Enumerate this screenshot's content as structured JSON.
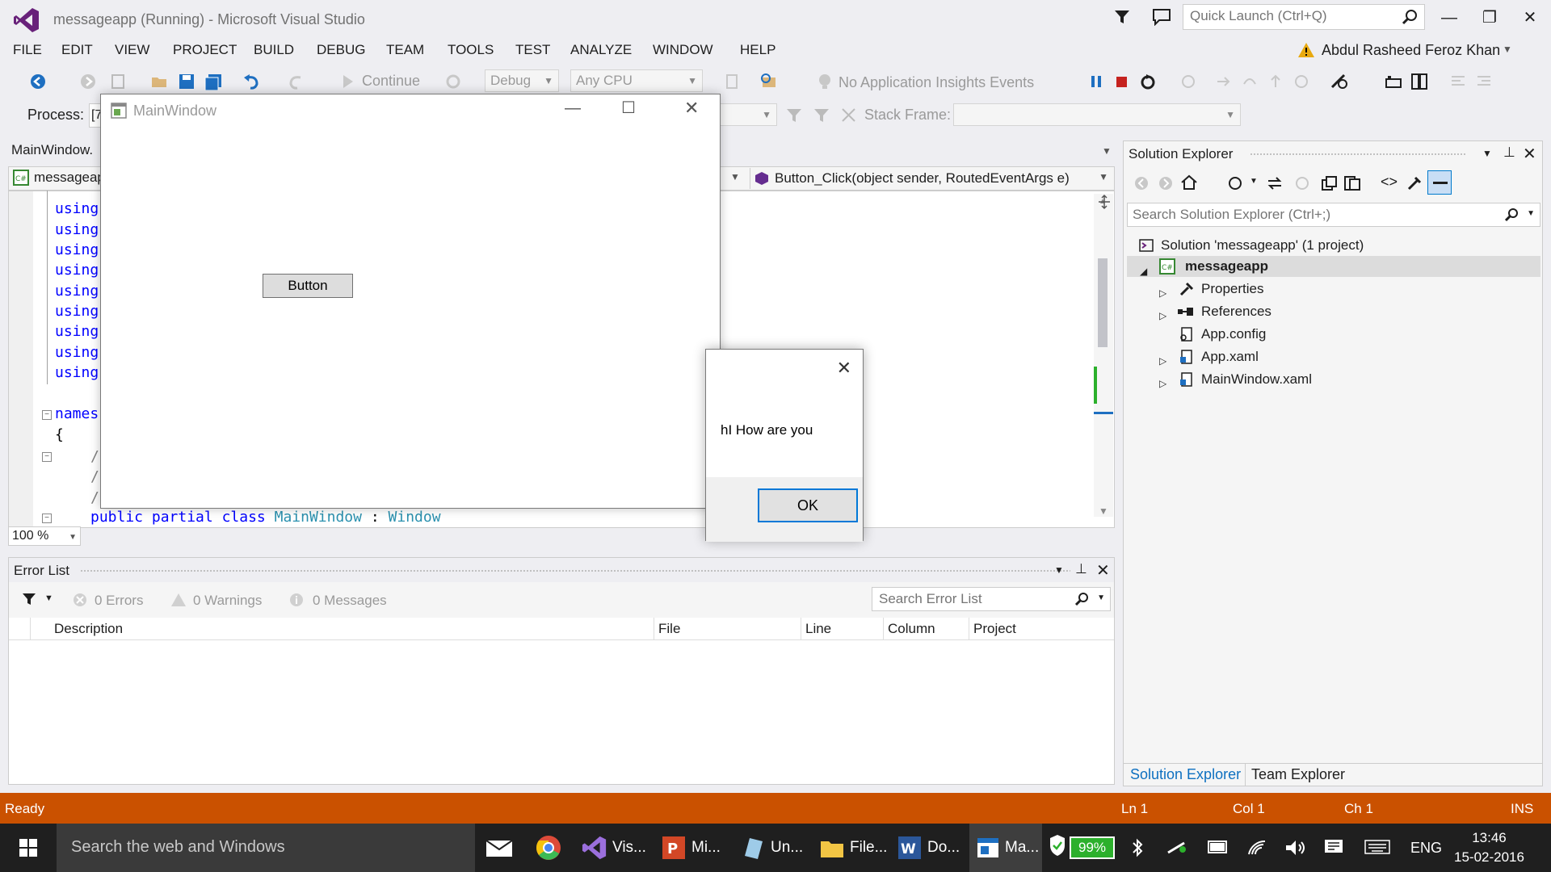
{
  "titlebar": {
    "title": "messageapp (Running) - Microsoft Visual Studio",
    "quick_launch_placeholder": "Quick Launch (Ctrl+Q)"
  },
  "menu": [
    "FILE",
    "EDIT",
    "VIEW",
    "PROJECT",
    "BUILD",
    "DEBUG",
    "TEAM",
    "TOOLS",
    "TEST",
    "ANALYZE",
    "WINDOW",
    "HELP"
  ],
  "user": {
    "name": "Abdul Rasheed Feroz Khan"
  },
  "toolbar": {
    "continue_label": "Continue",
    "config": "Debug",
    "platform": "Any CPU",
    "insights": "No Application Insights Events",
    "process_label": "Process:",
    "process_value": "[7",
    "stack_frame_label": "Stack Frame:"
  },
  "editor": {
    "tab_label": "MainWindow.",
    "project_combo": "messageap",
    "member_combo": "Button_Click(object sender, RoutedEventArgs e)",
    "code_lines": [
      "using",
      "using",
      "using",
      "using",
      "using",
      "using",
      "using",
      "using",
      "using"
    ],
    "namespace_text": "names",
    "brace": "{",
    "comment1": "/",
    "comment2": "/",
    "comment3": "/",
    "class_kw1": "public",
    "class_kw2": "partial",
    "class_kw3": "class",
    "class_name": "MainWindow",
    "colon": ":",
    "base_class": "Window",
    "zoom": "100 %"
  },
  "error_list": {
    "title": "Error List",
    "errors": "0 Errors",
    "warnings": "0 Warnings",
    "messages": "0 Messages",
    "search_placeholder": "Search Error List",
    "columns": [
      "Description",
      "File",
      "Line",
      "Column",
      "Project"
    ]
  },
  "solution_explorer": {
    "title": "Solution Explorer",
    "search_placeholder": "Search Solution Explorer (Ctrl+;)",
    "solution": "Solution 'messageapp' (1 project)",
    "project": "messageapp",
    "items": [
      "Properties",
      "References",
      "App.config",
      "App.xaml",
      "MainWindow.xaml"
    ],
    "tabs": [
      "Solution Explorer",
      "Team Explorer"
    ]
  },
  "statusbar": {
    "ready": "Ready",
    "ln": "Ln 1",
    "col": "Col 1",
    "ch": "Ch 1",
    "ins": "INS"
  },
  "main_window": {
    "title": "MainWindow",
    "button_label": "Button"
  },
  "message_box": {
    "text": "hI How are you",
    "ok": "OK"
  },
  "taskbar": {
    "search_placeholder": "Search the web and Windows",
    "apps": [
      "Vis...",
      "Mi...",
      "Un...",
      "File...",
      "Do...",
      "Ma..."
    ],
    "battery": "99%",
    "lang": "ENG",
    "time": "13:46",
    "date": "15-02-2016"
  },
  "colors": {
    "status_orange": "#ca5100",
    "vs_purple": "#68217a",
    "accent_blue": "#007acc"
  }
}
